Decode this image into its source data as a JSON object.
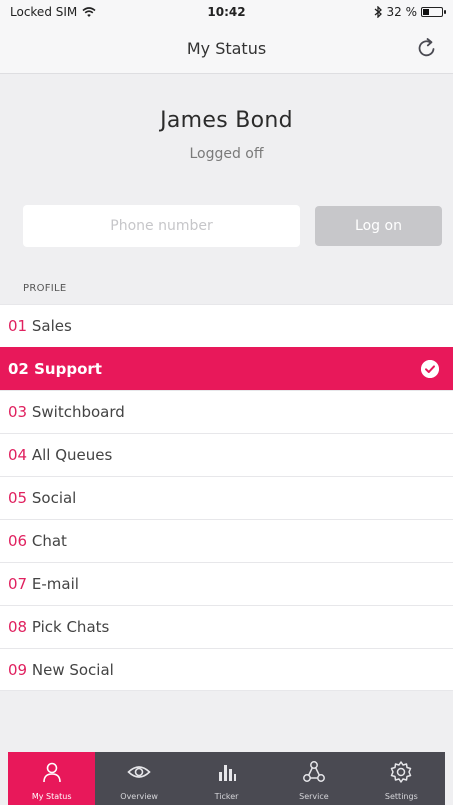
{
  "status_bar": {
    "carrier": "Locked SIM",
    "time": "10:42",
    "battery_text": "32 %",
    "battery_level": 0.32
  },
  "nav": {
    "title": "My Status"
  },
  "user": {
    "name": "James Bond",
    "status": "Logged off"
  },
  "login": {
    "phone_placeholder": "Phone number",
    "logon_label": "Log on"
  },
  "profile": {
    "section_label": "PROFILE",
    "items": [
      {
        "num": "01",
        "label": "Sales",
        "selected": false
      },
      {
        "num": "02",
        "label": "Support",
        "selected": true
      },
      {
        "num": "03",
        "label": "Switchboard",
        "selected": false
      },
      {
        "num": "04",
        "label": "All Queues",
        "selected": false
      },
      {
        "num": "05",
        "label": "Social",
        "selected": false
      },
      {
        "num": "06",
        "label": "Chat",
        "selected": false
      },
      {
        "num": "07",
        "label": "E-mail",
        "selected": false
      },
      {
        "num": "08",
        "label": "Pick Chats",
        "selected": false
      },
      {
        "num": "09",
        "label": "New Social",
        "selected": false
      }
    ]
  },
  "tabs": [
    {
      "label": "My Status",
      "icon": "person-icon",
      "active": true
    },
    {
      "label": "Overview",
      "icon": "eye-icon",
      "active": false
    },
    {
      "label": "Ticker",
      "icon": "bar-chart-icon",
      "active": false
    },
    {
      "label": "Service",
      "icon": "network-icon",
      "active": false
    },
    {
      "label": "Settings",
      "icon": "gear-icon",
      "active": false
    }
  ],
  "colors": {
    "accent": "#e8185a",
    "tabbar": "#4a4a52",
    "background": "#efeff1",
    "button_disabled": "#c7c7ca"
  }
}
